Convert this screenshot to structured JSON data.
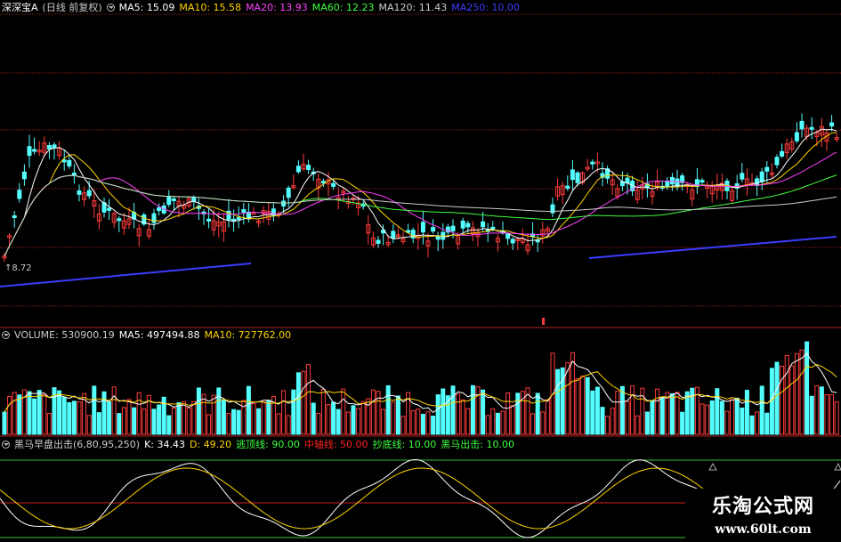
{
  "main_panel": {
    "title": "深深宝A",
    "period": "(日线 前复权)",
    "ma": [
      {
        "label": "MA5: 15.09",
        "color": "#ffffff"
      },
      {
        "label": "MA10: 15.58",
        "color": "#ffd400"
      },
      {
        "label": "MA20: 13.93",
        "color": "#ff40ff"
      },
      {
        "label": "MA60: 12.23",
        "color": "#40ff40"
      },
      {
        "label": "MA120: 11.43",
        "color": "#cccccc"
      },
      {
        "label": "MA250: 10.00",
        "color": "#3c3cff"
      }
    ],
    "low_price_label": "8.72",
    "colors": {
      "up": "#ff3c3c",
      "down": "#54ffff",
      "grid": "#8a1a1a"
    }
  },
  "volume_panel": {
    "title": "VOLUME: 530900.19",
    "ma": [
      {
        "label": "MA5: 497494.88",
        "color": "#ffffff"
      },
      {
        "label": "MA10: 727762.00",
        "color": "#ffd400"
      }
    ]
  },
  "indicator_panel": {
    "title": "黑马早盘出击(6,80,95,250)",
    "values": [
      {
        "label": "K: 34.43",
        "color": "#ffffff"
      },
      {
        "label": "D: 49.20",
        "color": "#ffd400"
      },
      {
        "label": "逃顶线: 90.00",
        "color": "#40ff40"
      },
      {
        "label": "中轴线: 50.00",
        "color": "#ff2020"
      },
      {
        "label": "抄底线: 10.00",
        "color": "#40ff40"
      },
      {
        "label": "黑马出击: 10.00",
        "color": "#40ff40"
      }
    ]
  },
  "watermark": {
    "name": "乐淘公式网",
    "url": "www.60lt.com"
  }
}
